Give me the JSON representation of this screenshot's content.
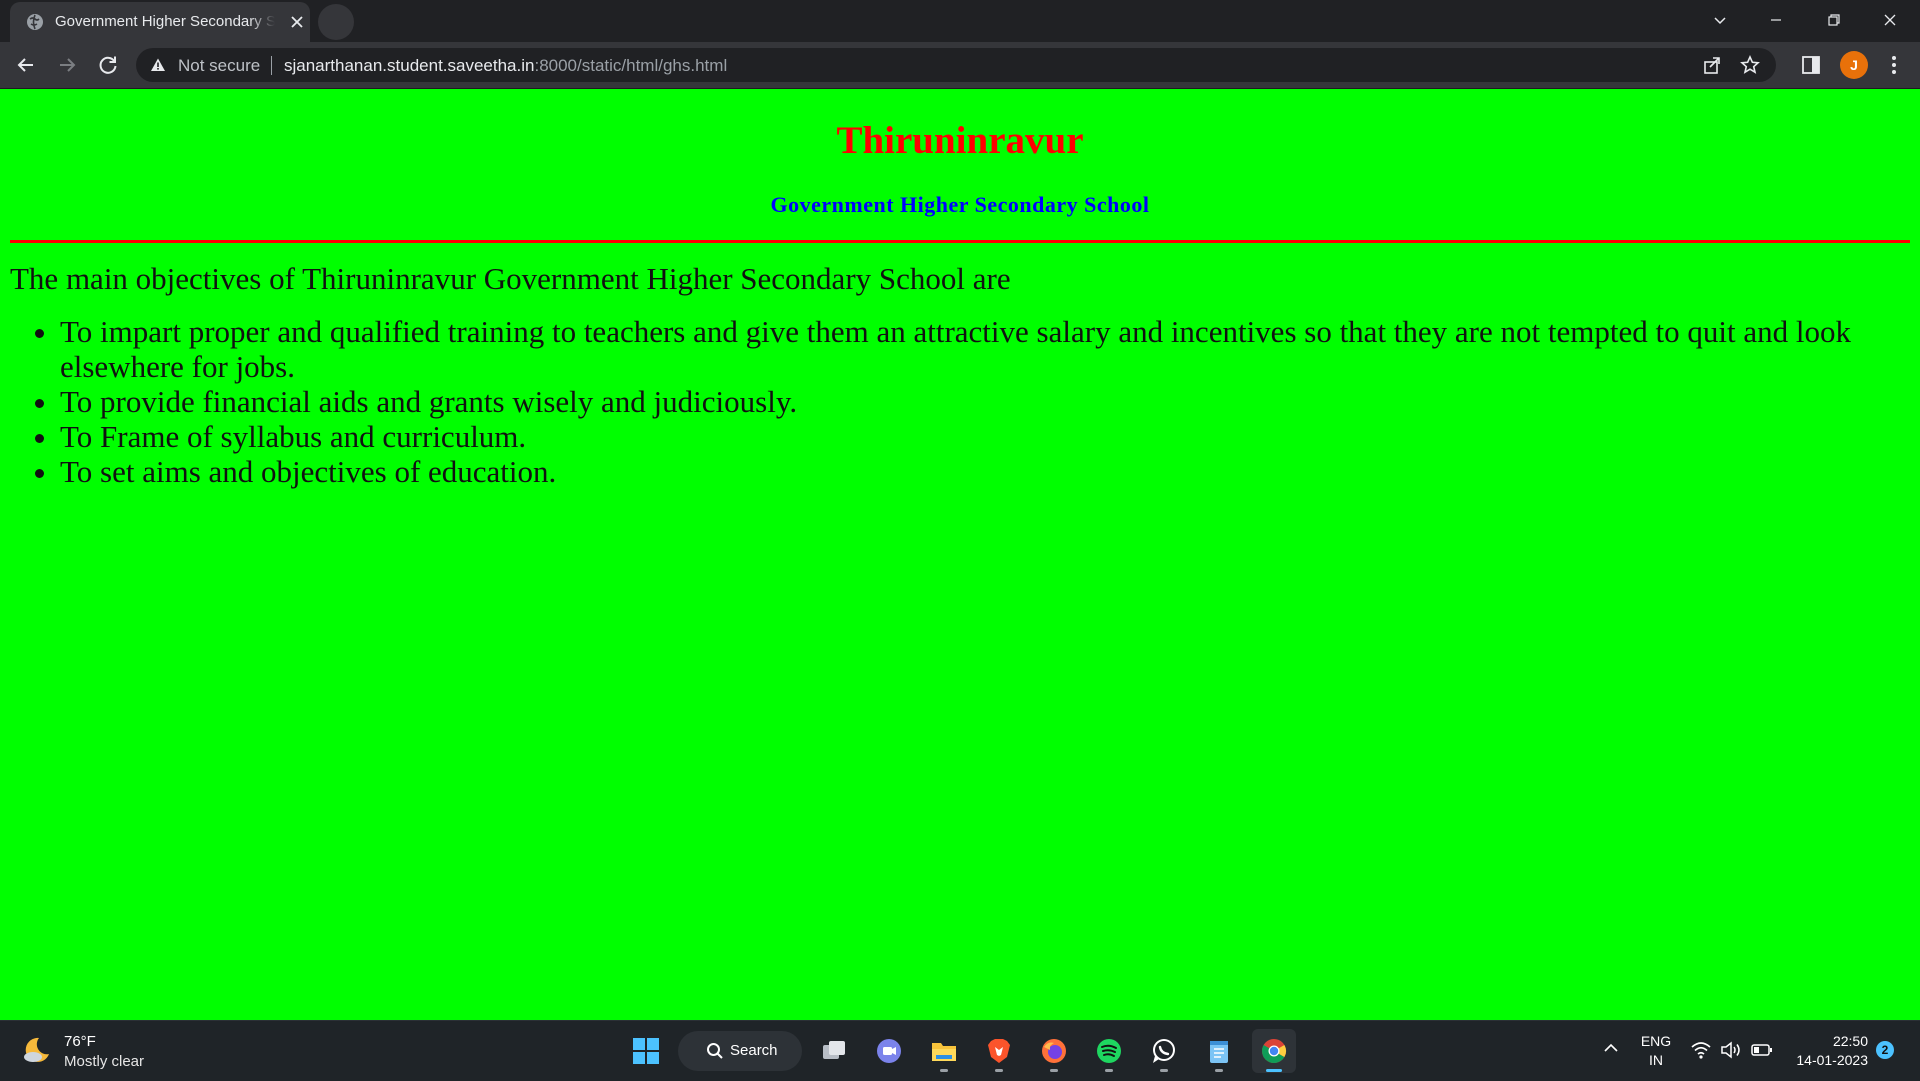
{
  "browser": {
    "tab_title": "Government Higher Secondary School",
    "security_label": "Not secure",
    "url_host": "sjanarthanan.student.saveetha.in",
    "url_path": ":8000/static/html/ghs.html",
    "profile_initial": "J"
  },
  "page": {
    "heading": "Thiruninravur",
    "subheading": "Government Higher Secondary School",
    "intro": "The main objectives of Thiruninravur Government Higher Secondary School are",
    "objectives": [
      "To impart proper and qualified training to teachers and give them an attractive salary and incentives so that they are not tempted to quit and look elsewhere for jobs.",
      "To provide financial aids and grants wisely and judiciously.",
      "To Frame of syllabus and curriculum.",
      "To set aims and objectives of education."
    ],
    "colors": {
      "background": "#00ff00",
      "heading": "#ff0000",
      "subheading": "#0000ff",
      "rule": "#ff0000"
    }
  },
  "taskbar": {
    "weather_temp": "76°F",
    "weather_condition": "Mostly clear",
    "search_label": "Search",
    "apps": [
      "windows-start-icon",
      "task-view-icon",
      "teams-chat-icon",
      "file-explorer-icon",
      "brave-browser-icon",
      "firefox-icon",
      "spotify-icon",
      "whatsapp-icon",
      "notepad-icon",
      "chrome-icon"
    ],
    "language_line1": "ENG",
    "language_line2": "IN",
    "time": "22:50",
    "date": "14-01-2023",
    "notification_count": "2"
  }
}
